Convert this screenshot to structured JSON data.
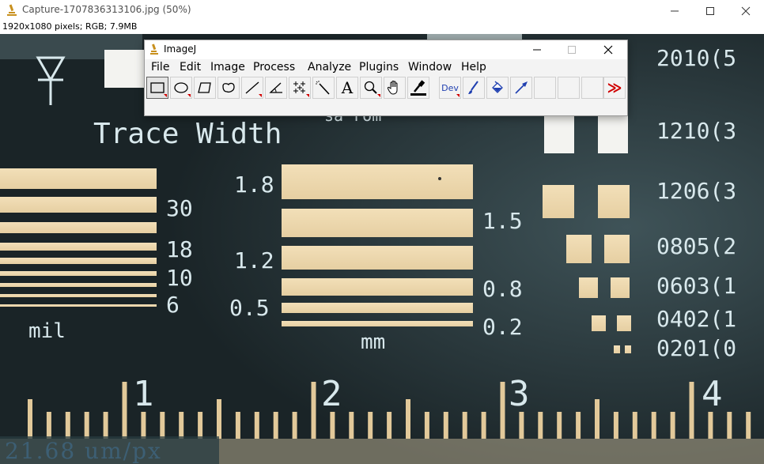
{
  "window": {
    "title": "Capture-1707836313106.jpg (50%)",
    "info": "1920x1080 pixels; RGB; 7.9MB",
    "minimize_symbol": "—",
    "close_symbol": "✕"
  },
  "pcb": {
    "heading": "Trace Width",
    "partial_text": "sa rom",
    "mil_values": [
      "30",
      "18",
      "10",
      "6"
    ],
    "mil_unit": "mil",
    "mm_values_left": [
      "1.8",
      "1.2",
      "0.5"
    ],
    "mm_values_right": [
      "1.5",
      "0.8",
      "0.2"
    ],
    "mm_unit": "mm",
    "package_labels": [
      "2010(5",
      "1210(3",
      "1206(3",
      "0805(2",
      "0603(1",
      "0402(1",
      "0201(0"
    ],
    "ruler_labels": [
      "1",
      "2",
      "3",
      "4"
    ],
    "scale": "21.68 um/px"
  },
  "imagej": {
    "title": "ImageJ",
    "menu": [
      "File",
      "Edit",
      "Image",
      "Process",
      "Analyze",
      "Plugins",
      "Window",
      "Help"
    ],
    "tools": [
      {
        "name": "rectangle-tool-icon"
      },
      {
        "name": "oval-tool-icon"
      },
      {
        "name": "polygon-tool-icon"
      },
      {
        "name": "freehand-tool-icon"
      },
      {
        "name": "line-tool-icon"
      },
      {
        "name": "angle-tool-icon"
      },
      {
        "name": "multipoint-tool-icon"
      },
      {
        "name": "wand-tool-icon"
      },
      {
        "name": "text-tool-icon"
      },
      {
        "name": "magnifier-tool-icon"
      },
      {
        "name": "hand-tool-icon"
      },
      {
        "name": "dropper-tool-icon"
      },
      {
        "name": "developer-menu-icon"
      },
      {
        "name": "brush-tool-icon"
      },
      {
        "name": "flood-fill-tool-icon"
      },
      {
        "name": "arrow-tool-icon"
      },
      {
        "name": "more-tools-icon"
      }
    ],
    "text_tool_glyph": "A",
    "dev_label": "Dev",
    "more_glyph": "≫"
  },
  "colors": {
    "pcb_bg": "#1c2b30",
    "copper": "#eed9ae",
    "silk": "#d8e8ec",
    "accent_red": "#d00000"
  }
}
